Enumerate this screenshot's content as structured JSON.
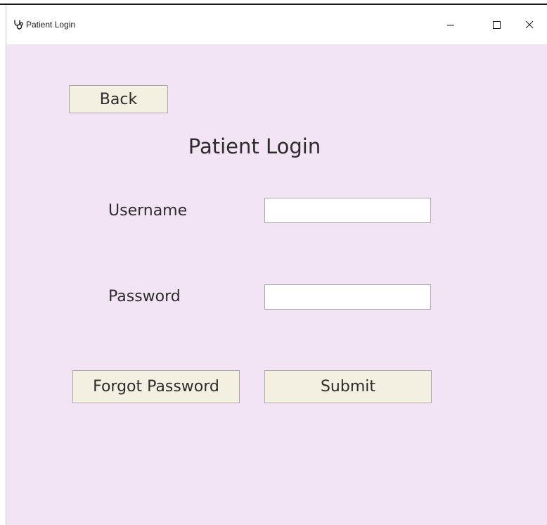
{
  "window": {
    "title": "Patient Login",
    "icon": "stethoscope-icon",
    "controls": {
      "minimize_icon": "minimize-icon",
      "maximize_icon": "maximize-icon",
      "close_icon": "close-icon"
    }
  },
  "form": {
    "back_label": "Back",
    "heading": "Patient Login",
    "username_label": "Username",
    "username_value": "",
    "password_label": "Password",
    "password_value": "",
    "forgot_label": "Forgot Password",
    "submit_label": "Submit"
  },
  "colors": {
    "background": "#f2e4f4",
    "button": "#f3f0e2",
    "text": "#2c2c2c"
  }
}
